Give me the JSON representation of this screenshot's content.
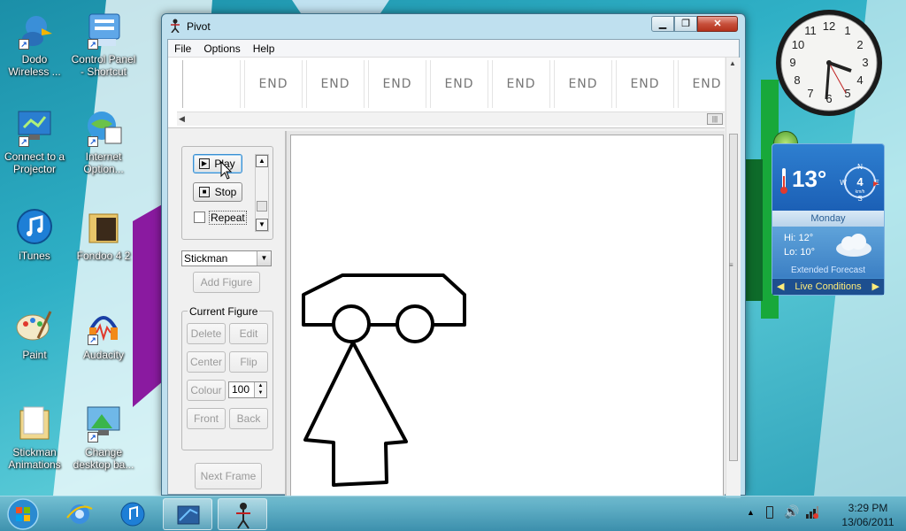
{
  "desktop_icons": [
    {
      "label": "Dodo Wireless ..."
    },
    {
      "label": "Control Panel - Shortcut"
    },
    {
      "label": "Connect to a Projector"
    },
    {
      "label": "Internet Option..."
    },
    {
      "label": "iTunes"
    },
    {
      "label": "Fondoo 4 2"
    },
    {
      "label": "Paint"
    },
    {
      "label": "Audacity"
    },
    {
      "label": "Stickman Animations"
    },
    {
      "label": "Change desktop ba..."
    }
  ],
  "window": {
    "title": "Pivot",
    "menu": [
      "File",
      "Options",
      "Help"
    ],
    "frames": [
      "END",
      "END",
      "END",
      "END",
      "END",
      "END",
      "END",
      "END"
    ]
  },
  "controls": {
    "play_label": "Play",
    "stop_label": "Stop",
    "repeat_label": "Repeat",
    "repeat_checked": false,
    "figure_type": "Stickman",
    "add_figure_label": "Add Figure",
    "current_figure_label": "Current Figure",
    "delete_label": "Delete",
    "edit_label": "Edit",
    "center_label": "Center",
    "flip_label": "Flip",
    "colour_label": "Colour",
    "colour_value": "100",
    "front_label": "Front",
    "back_label": "Back",
    "next_frame_label": "Next Frame"
  },
  "weather": {
    "temperature": "13°",
    "wind_speed": "4",
    "wind_unit": "km/h",
    "compass": [
      "N",
      "E",
      "S",
      "W"
    ],
    "day": "Monday",
    "hi": "Hi: 12°",
    "lo": "Lo: 10°",
    "extended": "Extended Forecast",
    "live": "Live Conditions"
  },
  "clock_gadget": {
    "numbers": [
      "12",
      "1",
      "2",
      "3",
      "4",
      "5",
      "6",
      "7",
      "8",
      "9",
      "10",
      "11"
    ]
  },
  "taskbar": {
    "time": "3:29 PM",
    "date": "13/06/2011"
  },
  "colors": {
    "accent": "#1b5fb5",
    "close_red": "#c7503b"
  }
}
